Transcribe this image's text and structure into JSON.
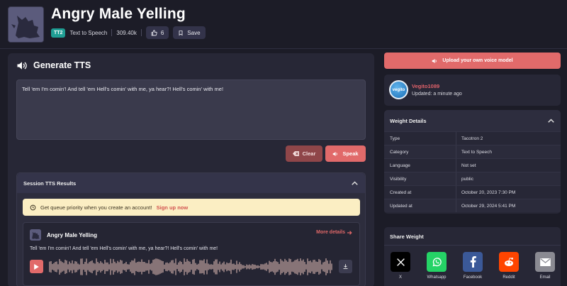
{
  "header": {
    "title": "Angry Male Yelling",
    "badge": "TT2",
    "category": "Text to Speech",
    "uses": "309.40k",
    "likes": "6",
    "save_label": "Save"
  },
  "generate": {
    "title": "Generate TTS",
    "text_value": "Tell 'em I'm comin'! And tell 'em Hell's comin' with me, ya hear?! Hell's comin' with me!",
    "clear_label": "Clear",
    "speak_label": "Speak"
  },
  "session": {
    "title": "Session TTS Results",
    "notice_text": "Get queue priority when you create an account!",
    "notice_link": "Sign up now",
    "result": {
      "title": "Angry Male Yelling",
      "more_details": "More details",
      "text": "Tell 'em I'm comin'! And tell 'em Hell's comin' with me, ya hear?! Hell's comin' with me!"
    }
  },
  "sidebar": {
    "upload_label": "Upload your own voice model",
    "user": {
      "name": "Vegito1089",
      "avatar_text": "vegito",
      "updated": "Updated: a minute ago"
    },
    "weights": {
      "title": "Weight Details",
      "rows": [
        {
          "key": "Type",
          "value": "Tacotron 2"
        },
        {
          "key": "Category",
          "value": "Text to Speech"
        },
        {
          "key": "Language",
          "value": "Not set"
        },
        {
          "key": "Visibility",
          "value": "public"
        },
        {
          "key": "Created at",
          "value": "October 20, 2023 7:30 PM"
        },
        {
          "key": "Updated at",
          "value": "October 29, 2024 5:41 PM"
        }
      ]
    },
    "share": {
      "title": "Share Weight",
      "items": [
        {
          "label": "X",
          "icon": "x-icon",
          "color": "#000000"
        },
        {
          "label": "Whatsapp",
          "icon": "whatsapp-icon",
          "color": "#25d366"
        },
        {
          "label": "Facebook",
          "icon": "facebook-icon",
          "color": "#3b5998"
        },
        {
          "label": "Reddit",
          "icon": "reddit-icon",
          "color": "#ff4500"
        },
        {
          "label": "Email",
          "icon": "email-icon",
          "color": "#8a8a92"
        }
      ]
    }
  },
  "colors": {
    "accent": "#e16a6a",
    "background": "#1c1c27",
    "panel": "#272736",
    "badge": "#1f9e94"
  }
}
